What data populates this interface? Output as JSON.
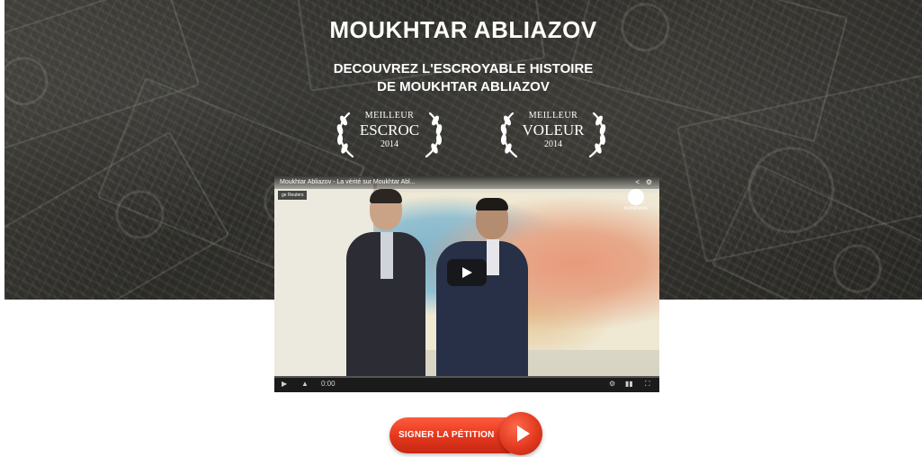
{
  "hero": {
    "title": "MOUKHTAR ABLIAZOV",
    "subtitle_line1": "DECOUVREZ L'ESCROYABLE HISTOIRE",
    "subtitle_line2": "DE MOUKHTAR ABLIAZOV",
    "awards": [
      {
        "line1": "MEILLEUR",
        "line2": "ESCROC",
        "line3": "2014"
      },
      {
        "line1": "MEILLEUR",
        "line2": "VOLEUR",
        "line3": "2014"
      }
    ]
  },
  "video": {
    "title": "Moukhtar Abliazov - La vérité sur Moukhtar Abl...",
    "small_label": "ge Reuters",
    "channel": "euronews",
    "time": "0:00",
    "icons": {
      "share": "share-icon",
      "settings": "gear-icon",
      "play": "play-icon",
      "volume": "volume-icon",
      "fullscreen": "fullscreen-icon",
      "youtube": "youtube-logo"
    }
  },
  "cta": {
    "label": "SIGNER LA PÉTITION",
    "color": "#e2361d"
  }
}
